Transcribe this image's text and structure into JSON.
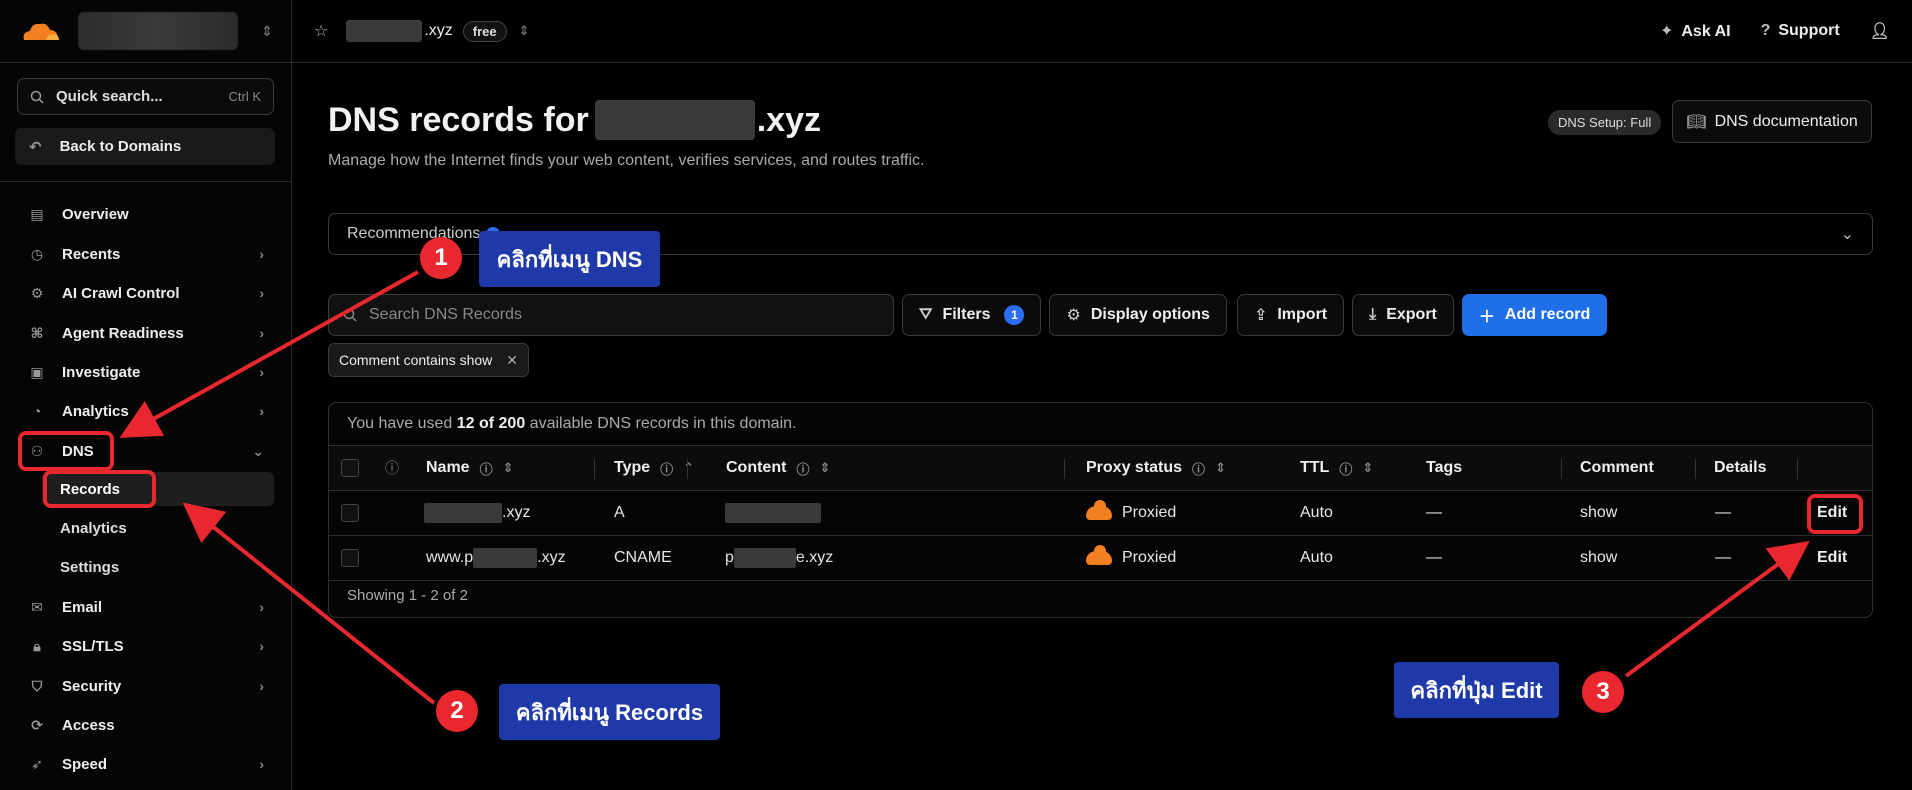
{
  "sidebar": {
    "search_label": "Quick search...",
    "search_kbd": "Ctrl K",
    "back_label": "Back to Domains",
    "items": [
      {
        "label": "Overview"
      },
      {
        "label": "Recents"
      },
      {
        "label": "AI Crawl Control"
      },
      {
        "label": "Agent Readiness"
      },
      {
        "label": "Investigate"
      },
      {
        "label": "Analytics"
      },
      {
        "label": "DNS"
      },
      {
        "label": "Records"
      },
      {
        "label": "Analytics"
      },
      {
        "label": "Settings"
      },
      {
        "label": "Email"
      },
      {
        "label": "SSL/TLS"
      },
      {
        "label": "Security"
      },
      {
        "label": "Access"
      },
      {
        "label": "Speed"
      }
    ]
  },
  "topbar": {
    "domain_suffix": ".xyz",
    "plan": "free",
    "ask_ai": "Ask AI",
    "support": "Support"
  },
  "page": {
    "title_prefix": "DNS records for",
    "title_suffix": ".xyz",
    "subtitle": "Manage how the Internet finds your web content, verifies services, and routes traffic.",
    "setup_badge": "DNS Setup: Full",
    "doc_button": "DNS documentation",
    "recommendations": "Recommendations"
  },
  "toolbar": {
    "search_placeholder": "Search DNS Records",
    "filters": "Filters",
    "filters_count": "1",
    "display_options": "Display options",
    "import": "Import",
    "export": "Export",
    "add_record": "Add record",
    "chip": "Comment contains show"
  },
  "table": {
    "usage_prefix": "You have used",
    "usage_bold": "12 of 200",
    "usage_suffix": "available DNS records in this domain.",
    "headers": {
      "name": "Name",
      "type": "Type",
      "content": "Content",
      "proxy": "Proxy status",
      "ttl": "TTL",
      "tags": "Tags",
      "comment": "Comment",
      "details": "Details"
    },
    "rows": [
      {
        "name_suffix": ".xyz",
        "type": "A",
        "content_suffix": "",
        "proxy": "Proxied",
        "ttl": "Auto",
        "tags": "—",
        "comment": "show",
        "details": "—",
        "action": "Edit"
      },
      {
        "name_prefix": "www.p",
        "name_suffix": ".xyz",
        "type": "CNAME",
        "content_prefix": "p",
        "content_suffix": "e.xyz",
        "proxy": "Proxied",
        "ttl": "Auto",
        "tags": "—",
        "comment": "show",
        "details": "—",
        "action": "Edit"
      }
    ],
    "footer": "Showing 1 - 2 of 2"
  },
  "annotations": {
    "step1_num": "1",
    "step1_text": "คลิกที่เมนู DNS",
    "step2_num": "2",
    "step2_text": "คลิกที่เมนู Records",
    "step3_num": "3",
    "step3_text": "คลิกที่ปุ่ม Edit"
  },
  "colors": {
    "accent": "#1f6fe8",
    "annotation_red": "#e8282e",
    "callout_blue": "#1f3aa8",
    "proxied_orange": "#f38020"
  }
}
